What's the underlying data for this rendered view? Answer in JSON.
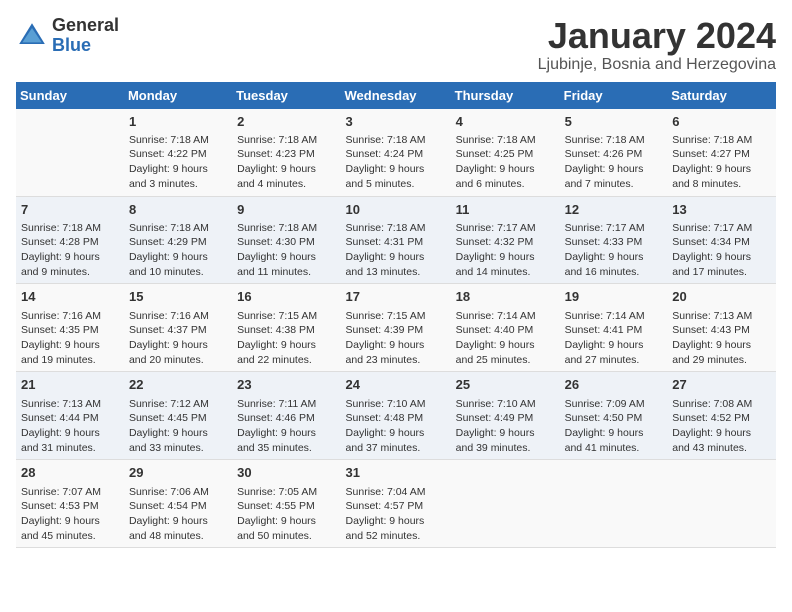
{
  "header": {
    "logo_general": "General",
    "logo_blue": "Blue",
    "month_year": "January 2024",
    "location": "Ljubinje, Bosnia and Herzegovina"
  },
  "days_of_week": [
    "Sunday",
    "Monday",
    "Tuesday",
    "Wednesday",
    "Thursday",
    "Friday",
    "Saturday"
  ],
  "weeks": [
    {
      "bg": "white",
      "days": [
        {
          "number": "",
          "content": ""
        },
        {
          "number": "1",
          "content": "Sunrise: 7:18 AM\nSunset: 4:22 PM\nDaylight: 9 hours\nand 3 minutes."
        },
        {
          "number": "2",
          "content": "Sunrise: 7:18 AM\nSunset: 4:23 PM\nDaylight: 9 hours\nand 4 minutes."
        },
        {
          "number": "3",
          "content": "Sunrise: 7:18 AM\nSunset: 4:24 PM\nDaylight: 9 hours\nand 5 minutes."
        },
        {
          "number": "4",
          "content": "Sunrise: 7:18 AM\nSunset: 4:25 PM\nDaylight: 9 hours\nand 6 minutes."
        },
        {
          "number": "5",
          "content": "Sunrise: 7:18 AM\nSunset: 4:26 PM\nDaylight: 9 hours\nand 7 minutes."
        },
        {
          "number": "6",
          "content": "Sunrise: 7:18 AM\nSunset: 4:27 PM\nDaylight: 9 hours\nand 8 minutes."
        }
      ]
    },
    {
      "bg": "gray",
      "days": [
        {
          "number": "7",
          "content": "Sunrise: 7:18 AM\nSunset: 4:28 PM\nDaylight: 9 hours\nand 9 minutes."
        },
        {
          "number": "8",
          "content": "Sunrise: 7:18 AM\nSunset: 4:29 PM\nDaylight: 9 hours\nand 10 minutes."
        },
        {
          "number": "9",
          "content": "Sunrise: 7:18 AM\nSunset: 4:30 PM\nDaylight: 9 hours\nand 11 minutes."
        },
        {
          "number": "10",
          "content": "Sunrise: 7:18 AM\nSunset: 4:31 PM\nDaylight: 9 hours\nand 13 minutes."
        },
        {
          "number": "11",
          "content": "Sunrise: 7:17 AM\nSunset: 4:32 PM\nDaylight: 9 hours\nand 14 minutes."
        },
        {
          "number": "12",
          "content": "Sunrise: 7:17 AM\nSunset: 4:33 PM\nDaylight: 9 hours\nand 16 minutes."
        },
        {
          "number": "13",
          "content": "Sunrise: 7:17 AM\nSunset: 4:34 PM\nDaylight: 9 hours\nand 17 minutes."
        }
      ]
    },
    {
      "bg": "white",
      "days": [
        {
          "number": "14",
          "content": "Sunrise: 7:16 AM\nSunset: 4:35 PM\nDaylight: 9 hours\nand 19 minutes."
        },
        {
          "number": "15",
          "content": "Sunrise: 7:16 AM\nSunset: 4:37 PM\nDaylight: 9 hours\nand 20 minutes."
        },
        {
          "number": "16",
          "content": "Sunrise: 7:15 AM\nSunset: 4:38 PM\nDaylight: 9 hours\nand 22 minutes."
        },
        {
          "number": "17",
          "content": "Sunrise: 7:15 AM\nSunset: 4:39 PM\nDaylight: 9 hours\nand 23 minutes."
        },
        {
          "number": "18",
          "content": "Sunrise: 7:14 AM\nSunset: 4:40 PM\nDaylight: 9 hours\nand 25 minutes."
        },
        {
          "number": "19",
          "content": "Sunrise: 7:14 AM\nSunset: 4:41 PM\nDaylight: 9 hours\nand 27 minutes."
        },
        {
          "number": "20",
          "content": "Sunrise: 7:13 AM\nSunset: 4:43 PM\nDaylight: 9 hours\nand 29 minutes."
        }
      ]
    },
    {
      "bg": "gray",
      "days": [
        {
          "number": "21",
          "content": "Sunrise: 7:13 AM\nSunset: 4:44 PM\nDaylight: 9 hours\nand 31 minutes."
        },
        {
          "number": "22",
          "content": "Sunrise: 7:12 AM\nSunset: 4:45 PM\nDaylight: 9 hours\nand 33 minutes."
        },
        {
          "number": "23",
          "content": "Sunrise: 7:11 AM\nSunset: 4:46 PM\nDaylight: 9 hours\nand 35 minutes."
        },
        {
          "number": "24",
          "content": "Sunrise: 7:10 AM\nSunset: 4:48 PM\nDaylight: 9 hours\nand 37 minutes."
        },
        {
          "number": "25",
          "content": "Sunrise: 7:10 AM\nSunset: 4:49 PM\nDaylight: 9 hours\nand 39 minutes."
        },
        {
          "number": "26",
          "content": "Sunrise: 7:09 AM\nSunset: 4:50 PM\nDaylight: 9 hours\nand 41 minutes."
        },
        {
          "number": "27",
          "content": "Sunrise: 7:08 AM\nSunset: 4:52 PM\nDaylight: 9 hours\nand 43 minutes."
        }
      ]
    },
    {
      "bg": "white",
      "days": [
        {
          "number": "28",
          "content": "Sunrise: 7:07 AM\nSunset: 4:53 PM\nDaylight: 9 hours\nand 45 minutes."
        },
        {
          "number": "29",
          "content": "Sunrise: 7:06 AM\nSunset: 4:54 PM\nDaylight: 9 hours\nand 48 minutes."
        },
        {
          "number": "30",
          "content": "Sunrise: 7:05 AM\nSunset: 4:55 PM\nDaylight: 9 hours\nand 50 minutes."
        },
        {
          "number": "31",
          "content": "Sunrise: 7:04 AM\nSunset: 4:57 PM\nDaylight: 9 hours\nand 52 minutes."
        },
        {
          "number": "",
          "content": ""
        },
        {
          "number": "",
          "content": ""
        },
        {
          "number": "",
          "content": ""
        }
      ]
    }
  ]
}
